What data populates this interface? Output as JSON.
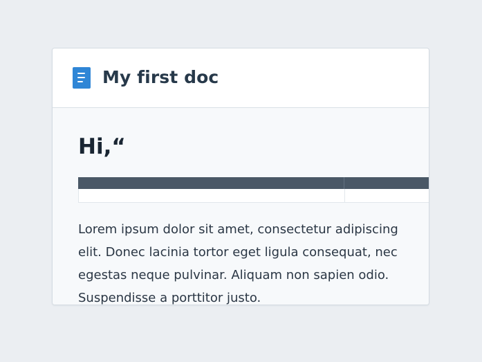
{
  "document": {
    "title": "My first doc",
    "icon": "document-icon",
    "accent_color": "#2f86d6"
  },
  "content": {
    "heading": "Hi,“",
    "paragraph": "Lorem ipsum dolor sit amet, consectetur adipiscing elit. Donec lacinia tortor eget ligula consequat, nec egestas neque pulvinar. Aliquam non sapien odio. Suspendisse a porttitor justo."
  }
}
